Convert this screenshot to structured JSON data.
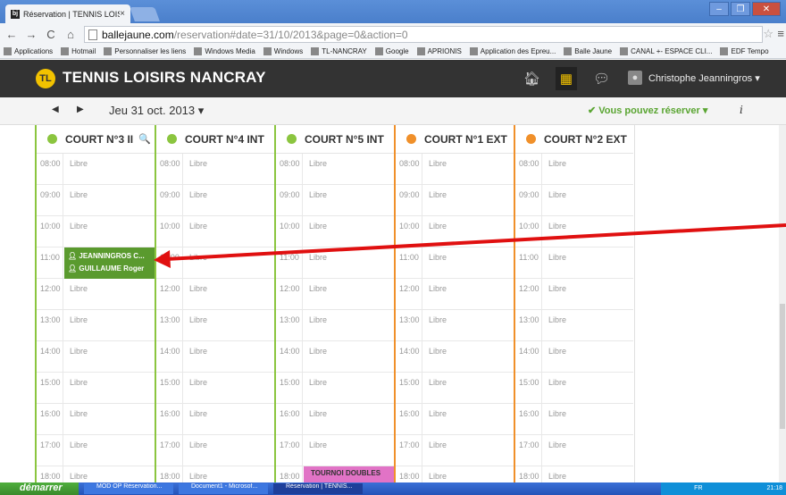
{
  "browser": {
    "tab_title": "Réservation | TENNIS LOISIR",
    "tab_close": "×",
    "url_host": "ballejaune.com",
    "url_path": "/reservation#date=31/10/2013&page=0&action=0",
    "window_buttons": [
      "–",
      "❐",
      "✕"
    ],
    "bookmarks": [
      "Applications",
      "Hotmail",
      "Personnaliser les liens",
      "Windows Media",
      "Windows",
      "TL-NANCRAY",
      "Google",
      "APRIONIS",
      "Application des Epreu...",
      "Balle Jaune",
      "CANAL +- ESPACE CLI...",
      "EDF Tempo"
    ]
  },
  "app": {
    "brand": "TENNIS LOISIRS NANCRAY",
    "user_name": "Christophe Jeanningros ▾",
    "date_label": "Jeu 31 oct. 2013 ▾",
    "reserve_status": "✔ Vous pouvez réserver ▾",
    "info_glyph": "i",
    "prev": "◀",
    "next": "▶"
  },
  "courts": [
    {
      "name": "COURT N°3 II",
      "type": "int",
      "zoom": "🔍"
    },
    {
      "name": "COURT N°4 INT",
      "type": "int"
    },
    {
      "name": "COURT N°5 INT",
      "type": "int"
    },
    {
      "name": "COURT N°1 EXT",
      "type": "ext"
    },
    {
      "name": "COURT N°2 EXT",
      "type": "ext"
    }
  ],
  "times": [
    "08:00",
    "09:00",
    "10:00",
    "11:00",
    "12:00",
    "13:00",
    "14:00",
    "15:00",
    "16:00",
    "17:00",
    "18:00"
  ],
  "slot_label": "Libre",
  "booking": {
    "court_index": 0,
    "time": "11:00",
    "players": [
      "JEANNINGROS C...",
      "GUILLAUME Roger"
    ]
  },
  "tournament": {
    "court_index": 2,
    "time": "18:00",
    "label": "TOURNOI DOUBLES"
  },
  "taskbar": {
    "start": "démarrer",
    "tasks": [
      "MOD OP Réservation...",
      "Document1 - Microsof...",
      "Réservation | TENNIS..."
    ],
    "lang": "FR",
    "clock": "21:18"
  },
  "colors": {
    "indoor": "#8bc53f",
    "outdoor": "#f0902a",
    "booked": "#5a9a2e",
    "tournament": "#e173c6",
    "arrow": "#e01010"
  }
}
